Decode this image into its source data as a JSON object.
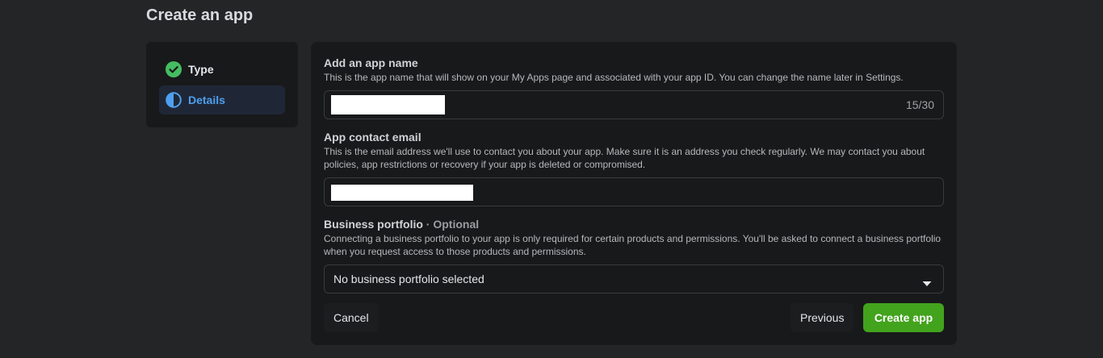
{
  "page": {
    "title": "Create an app"
  },
  "steps": [
    {
      "label": "Type",
      "status": "complete",
      "icon": "check-circle-icon",
      "color": "#45bd62"
    },
    {
      "label": "Details",
      "status": "in-progress",
      "icon": "half-circle-icon",
      "color": "#4e9fee"
    }
  ],
  "form": {
    "app_name": {
      "label": "Add an app name",
      "help": "This is the app name that will show on your My Apps page and associated with your app ID. You can change the name later in Settings.",
      "counter": "15/30"
    },
    "contact_email": {
      "label": "App contact email",
      "help": "This is the email address we'll use to contact you about your app. Make sure it is an address you check regularly. We may contact you about policies, app restrictions or recovery if your app is deleted or compromised."
    },
    "business_portfolio": {
      "label": "Business portfolio",
      "optional": "· Optional",
      "help": "Connecting a business portfolio to your app is only required for certain products and permissions. You'll be asked to connect a business portfolio when you request access to those products and permissions.",
      "selected": "No business portfolio selected"
    }
  },
  "buttons": {
    "cancel": "Cancel",
    "previous": "Previous",
    "create": "Create app"
  },
  "colors": {
    "background": "#242526",
    "card": "#18191a",
    "accent_blue": "#4e9fee",
    "success_green": "#45bd62",
    "primary_button": "#42a31d"
  }
}
